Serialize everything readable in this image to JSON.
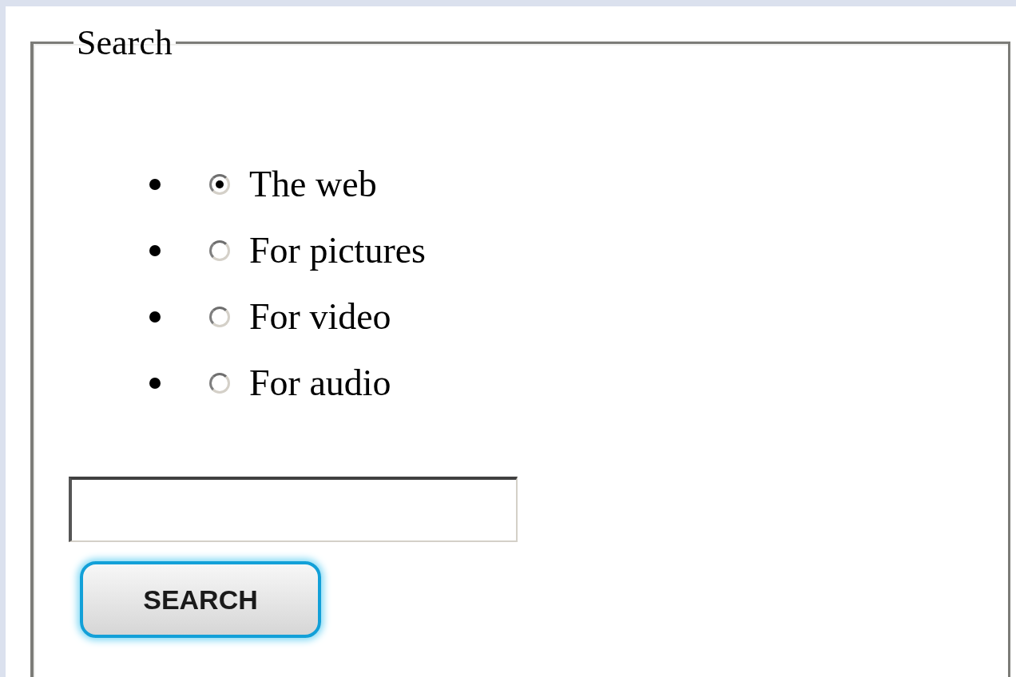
{
  "fieldset": {
    "legend": "Search"
  },
  "options": [
    {
      "label": "The web",
      "selected": true
    },
    {
      "label": "For pictures",
      "selected": false
    },
    {
      "label": "For video",
      "selected": false
    },
    {
      "label": "For audio",
      "selected": false
    }
  ],
  "button": {
    "label": "SEARCH",
    "focused": true
  }
}
